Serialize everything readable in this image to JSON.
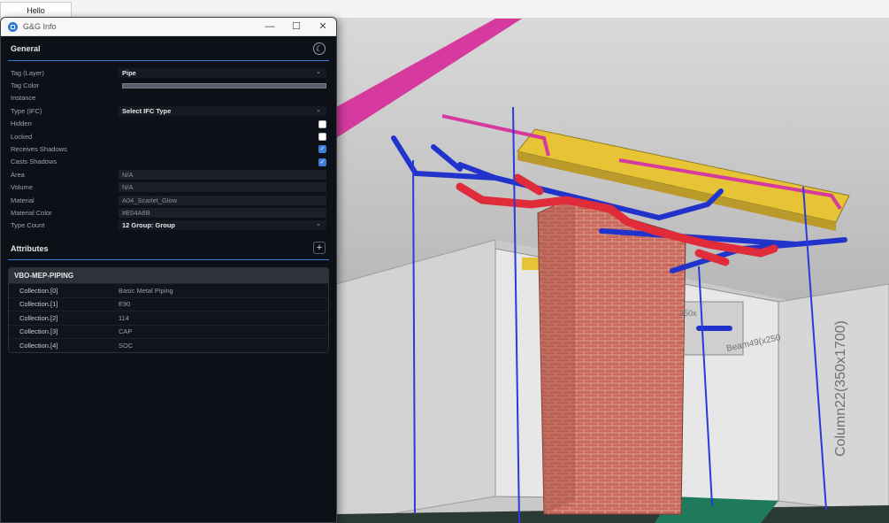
{
  "browser_tab": {
    "label": "Hello"
  },
  "window": {
    "title": "G&G Info",
    "controls": {
      "minimize": "—",
      "maximize": "☐",
      "close": "✕"
    }
  },
  "general": {
    "title": "General",
    "theme_icon": "moon-icon",
    "properties": [
      {
        "label": "Tag (Layer)",
        "kind": "select",
        "value": "Pipe"
      },
      {
        "label": "Tag Color",
        "kind": "color",
        "color": "#5b5c6b"
      },
      {
        "label": "Instance",
        "kind": "empty"
      },
      {
        "label": "Type (IFC)",
        "kind": "select",
        "value": "Select IFC Type"
      },
      {
        "label": "Hidden",
        "kind": "checkbox",
        "checked": false
      },
      {
        "label": "Locked",
        "kind": "checkbox",
        "checked": false
      },
      {
        "label": "Receives Shadows",
        "kind": "checkbox",
        "checked": true
      },
      {
        "label": "Casts Shadows",
        "kind": "checkbox",
        "checked": true
      },
      {
        "label": "Area",
        "kind": "readonly",
        "value": "N/A"
      },
      {
        "label": "Volume",
        "kind": "readonly",
        "value": "N/A"
      },
      {
        "label": "Material",
        "kind": "readonly",
        "value": "A04_Scarlet_Glow"
      },
      {
        "label": "Material Color",
        "kind": "readonly",
        "value": "#E04A6B"
      },
      {
        "label": "Type Count",
        "kind": "select",
        "value": "12 Group: Group"
      }
    ]
  },
  "attributes": {
    "title": "Attributes",
    "add_label": "+",
    "group": {
      "name": "VBO-MEP-PIPING",
      "rows": [
        {
          "key": "Collection.[0]",
          "value": "Basic Metal Piping"
        },
        {
          "key": "Collection.[1]",
          "value": "E90"
        },
        {
          "key": "Collection.[2]",
          "value": "114"
        },
        {
          "key": "Collection.[3]",
          "value": "CAP"
        },
        {
          "key": "Collection.[4]",
          "value": "SOC"
        }
      ]
    }
  },
  "viewport": {
    "labels": {
      "column": "Column22(350x1700)",
      "beam": "Beam49(x250",
      "beam_small": "250x"
    },
    "colors": {
      "pipe_red": "#e02b3a",
      "pipe_blue": "#2233cc",
      "pipe_magenta": "#d63a9e",
      "beam_yellow": "#e6c436",
      "brick": "#c8685a"
    }
  }
}
